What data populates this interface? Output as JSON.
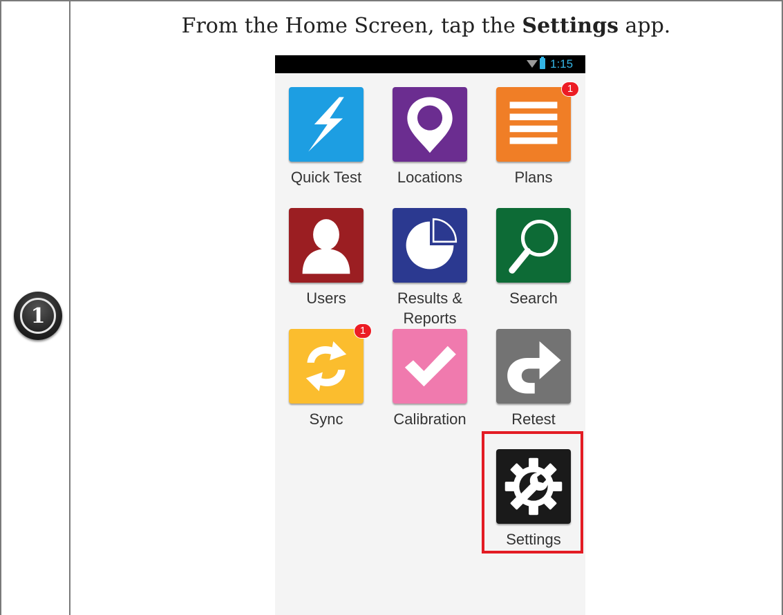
{
  "step": {
    "number": "1"
  },
  "instruction": {
    "prefix": "From the Home Screen, tap the ",
    "emphasis": "Settings",
    "suffix": " app."
  },
  "status_bar": {
    "time": "1:15",
    "icons": [
      "wifi-icon",
      "battery-icon"
    ],
    "time_color": "#34b5e5"
  },
  "apps": [
    {
      "id": "quick-test",
      "label": "Quick Test",
      "color": "#1d9ee2",
      "icon": "lightning-icon",
      "badge": null
    },
    {
      "id": "locations",
      "label": "Locations",
      "color": "#6b2d90",
      "icon": "map-pin-icon",
      "badge": null
    },
    {
      "id": "plans",
      "label": "Plans",
      "color": "#f07e26",
      "icon": "list-icon",
      "badge": "1"
    },
    {
      "id": "users",
      "label": "Users",
      "color": "#9b1e22",
      "icon": "user-icon",
      "badge": null
    },
    {
      "id": "results-reports",
      "label": "Results & Reports",
      "color": "#2b3990",
      "icon": "pie-chart-icon",
      "badge": null
    },
    {
      "id": "search",
      "label": "Search",
      "color": "#0d6b36",
      "icon": "magnifier-icon",
      "badge": null
    },
    {
      "id": "sync",
      "label": "Sync",
      "color": "#fbbd2e",
      "icon": "sync-icon",
      "badge": "1"
    },
    {
      "id": "calibration",
      "label": "Calibration",
      "color": "#f07aae",
      "icon": "checkmark-icon",
      "badge": null
    },
    {
      "id": "retest",
      "label": "Retest",
      "color": "#737373",
      "icon": "retest-arrow-icon",
      "badge": null
    },
    {
      "id": "settings",
      "label": "Settings",
      "color": "#1a1a1a",
      "icon": "gear-wrench-icon",
      "badge": null
    }
  ],
  "highlight": {
    "target": "settings",
    "color": "#e31c24"
  }
}
